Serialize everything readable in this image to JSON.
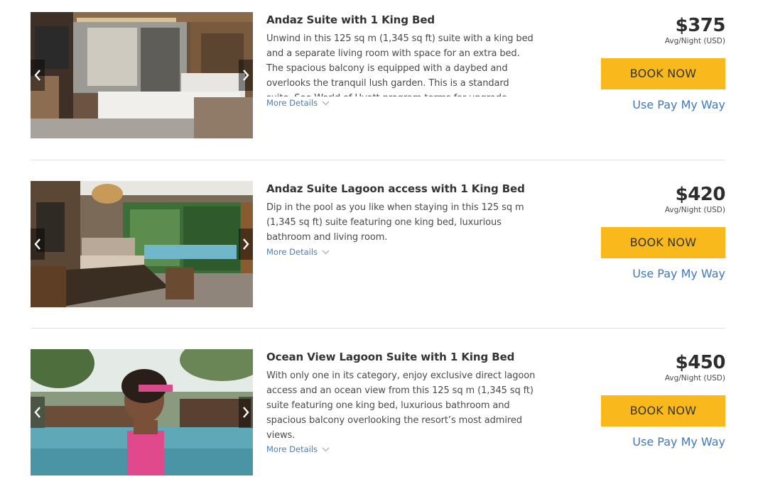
{
  "rooms": [
    {
      "title": "Andaz Suite with 1 King Bed",
      "description": "Unwind in this 125 sq m (1,345 sq ft) suite with a king bed and a separate living room with space for an extra bed. The spacious balcony is equipped with a daybed and overlooks the tranquil lush garden. This is a standard suite. See World of Hyatt program terms for upgrade",
      "more_details": "More Details",
      "price": "$375",
      "price_note": "Avg/Night (USD)",
      "book_label": "BOOK NOW",
      "pay_link": "Use Pay My Way"
    },
    {
      "title": "Andaz Suite Lagoon access with 1 King Bed",
      "description": "Dip in the pool as you like when staying in this 125 sq m (1,345 sq ft) suite featuring one king bed, luxurious bathroom and living room.",
      "more_details": "More Details",
      "price": "$420",
      "price_note": "Avg/Night (USD)",
      "book_label": "BOOK NOW",
      "pay_link": "Use Pay My Way"
    },
    {
      "title": "Ocean View Lagoon Suite with 1 King Bed",
      "description": "With only one in its category, enjoy exclusive direct lagoon access and an ocean view from this 125 sq m (1,345 sq ft) suite featuring one king bed, luxurious bathroom and spacious balcony overlooking the resort’s most admired views.",
      "more_details": "More Details",
      "price": "$450",
      "price_note": "Avg/Night (USD)",
      "book_label": "BOOK NOW",
      "pay_link": "Use Pay My Way"
    }
  ],
  "icons": {
    "carousel_prev": "chevron-left-icon",
    "carousel_next": "chevron-right-icon",
    "more_details": "chevron-down-icon"
  },
  "colors": {
    "book_button": "#f9b81c",
    "link": "#3f78be",
    "more_details": "#4d7db4",
    "divider": "#e2e2e2"
  }
}
